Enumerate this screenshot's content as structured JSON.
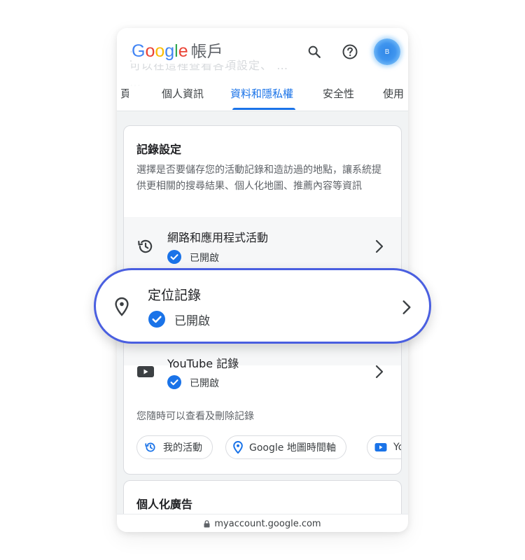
{
  "header": {
    "brand_google": "Google",
    "brand_account": "帳戶",
    "avatar_initial": "B",
    "ghost_lines": [
      "…",
      "可以在這裡查看各項設定、 …",
      "…"
    ]
  },
  "tabs": [
    {
      "label": "頁"
    },
    {
      "label": "個人資訊"
    },
    {
      "label": "資料和隱私權"
    },
    {
      "label": "安全性"
    },
    {
      "label": "使用"
    }
  ],
  "history_card": {
    "title": "記錄設定",
    "description": "選擇是否要儲存您的活動記錄和造訪過的地點，讓系統提供更相關的搜尋結果、個人化地圖、推薦內容等資訊",
    "rows": [
      {
        "title": "網路和應用程式活動",
        "status": "已開啟",
        "icon": "history-icon"
      },
      {
        "title": "YouTube 記錄",
        "status": "已開啟",
        "icon": "youtube-icon"
      }
    ],
    "footnote": "您隨時可以查看及刪除記錄",
    "chips": [
      {
        "label": "我的活動",
        "icon": "history-icon"
      },
      {
        "label": "Google 地圖時間軸",
        "icon": "location-pin-icon"
      },
      {
        "label": "Yo",
        "icon": "youtube-icon"
      }
    ]
  },
  "highlight": {
    "title": "定位記錄",
    "status": "已開啟",
    "icon": "location-pin-icon"
  },
  "ads_card": {
    "title": "個人化廣告"
  },
  "url_bar": {
    "url": "myaccount.google.com"
  },
  "colors": {
    "accent": "#1a73e8",
    "highlight_border": "#4a5fe0",
    "check_blue": "#1a73e8"
  }
}
